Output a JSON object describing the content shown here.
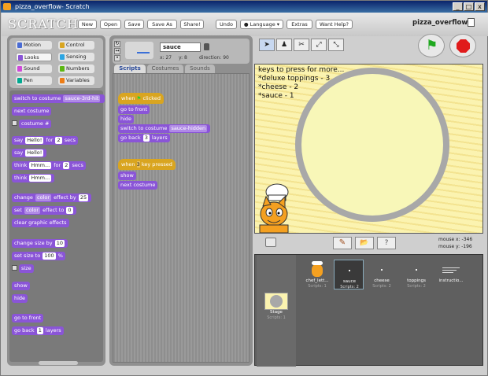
{
  "window": {
    "title": "pizza_overflow- Scratch",
    "min": "_",
    "max": "□",
    "close": "x"
  },
  "toolbar": {
    "logo": "SCRATCH",
    "buttons": [
      "New",
      "Open",
      "Save",
      "Save As",
      "Share!",
      "Undo",
      "Language",
      "Extras",
      "Want Help?"
    ],
    "project_title": "pizza_overflow"
  },
  "categories": [
    {
      "label": "Motion",
      "color": "#4a6cd4"
    },
    {
      "label": "Control",
      "color": "#d9a520"
    },
    {
      "label": "Looks",
      "color": "#8a55d7"
    },
    {
      "label": "Sensing",
      "color": "#2ca5e2"
    },
    {
      "label": "Sound",
      "color": "#cf4ad9"
    },
    {
      "label": "Numbers",
      "color": "#5cb712"
    },
    {
      "label": "Pen",
      "color": "#00a990"
    },
    {
      "label": "Variables",
      "color": "#ee7d16"
    }
  ],
  "palette": {
    "switch_to_costume": "switch to costume",
    "costume_value": "sauce-3rd-hit",
    "next_costume": "next costume",
    "costume_hash": "costume #",
    "say": "say",
    "hello": "Hello!",
    "for": "for",
    "secs": "secs",
    "two": "2",
    "think": "think",
    "hmm": "Hmm...",
    "change": "change",
    "color": "color",
    "effect_by": "effect by",
    "twentyfive": "25",
    "set": "set",
    "effect_to": "effect to",
    "zero": "0",
    "clear_effects": "clear graphic effects",
    "change_size_by": "change size by",
    "ten": "10",
    "set_size_to": "set size to",
    "hundred": "100",
    "pct": "%",
    "size": "size",
    "show": "show",
    "hide": "hide",
    "go_to_front": "go to front",
    "go_back": "go back",
    "one": "1",
    "layers": "layers"
  },
  "sprite": {
    "name": "sauce",
    "x": "x: 27",
    "y": "y: 8",
    "direction": "direction: 90"
  },
  "tabs": [
    "Scripts",
    "Costumes",
    "Sounds"
  ],
  "scripts": {
    "when_clicked": "when",
    "clicked": "clicked",
    "go_to_front": "go to front",
    "hide": "hide",
    "switch_to_costume": "switch to costume",
    "costume_hidden": "sauce-hidden",
    "go_back": "go back",
    "three": "3",
    "layers": "layers",
    "when_key": "when",
    "key_val": "3",
    "key_pressed": "key pressed",
    "show": "show",
    "next_costume": "next costume"
  },
  "stage": {
    "lines": [
      "keys to press for more...",
      "*deluxe toppings - 3",
      "*cheese - 2",
      "*sauce - 1"
    ],
    "mouse_x": "mouse x: -346",
    "mouse_y": "mouse y: -196"
  },
  "sprites": [
    {
      "name": "chef_lett...",
      "scripts": "Scripts: 1"
    },
    {
      "name": "sauce",
      "scripts": "Scripts: 2"
    },
    {
      "name": "cheese",
      "scripts": "Scripts: 2"
    },
    {
      "name": "toppings",
      "scripts": "Scripts: 2"
    },
    {
      "name": "instructio...",
      "scripts": ""
    }
  ],
  "stage_thumb": {
    "name": "Stage",
    "scripts": "Scripts: 1"
  }
}
